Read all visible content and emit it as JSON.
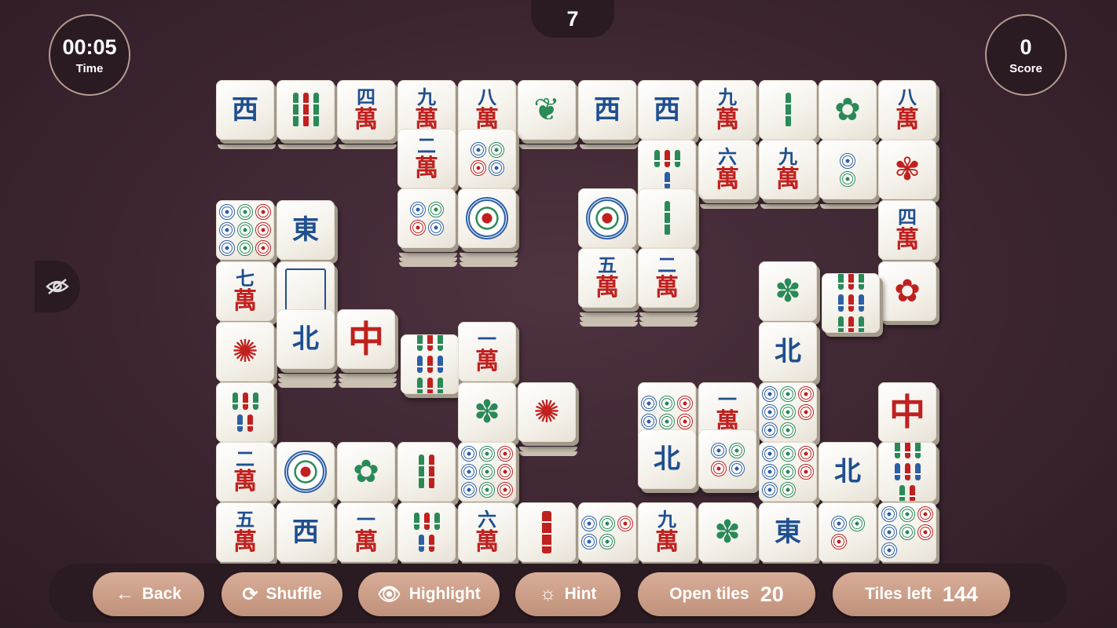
{
  "level": "7",
  "timer": {
    "value": "00:05",
    "label": "Time"
  },
  "score": {
    "value": "0",
    "label": "Score"
  },
  "buttons": {
    "back": "Back",
    "shuffle": "Shuffle",
    "highlight": "Highlight",
    "hint": "Hint"
  },
  "counters": {
    "open_label": "Open tiles",
    "open_value": "20",
    "left_label": "Tiles left",
    "left_value": "144"
  },
  "colors": {
    "background": "#3c2531",
    "panel": "#2a1a22",
    "button": "#c9a08a"
  },
  "tiles": [
    {
      "k": "wind",
      "t": "西"
    },
    {
      "k": "bam",
      "t": "3"
    },
    {
      "k": "crak",
      "n": "四"
    },
    {
      "k": "crak",
      "n": "九"
    },
    {
      "k": "crak",
      "n": "八"
    },
    {
      "k": "plant",
      "t": "❦"
    },
    {
      "k": "wind",
      "t": "西"
    },
    {
      "k": "wind",
      "t": "西"
    },
    {
      "k": "crak",
      "n": "九"
    },
    {
      "k": "bam",
      "t": "1"
    },
    {
      "k": "plant",
      "t": "✿"
    },
    {
      "k": "crak",
      "n": "八"
    },
    {
      "k": "crak",
      "n": "二"
    },
    {
      "k": "dots",
      "t": "4"
    },
    {
      "k": "bam",
      "t": "4"
    },
    {
      "k": "crak",
      "n": "六"
    },
    {
      "k": "crak",
      "n": "九"
    },
    {
      "k": "dots",
      "t": "2"
    },
    {
      "k": "flower",
      "t": "✾"
    },
    {
      "k": "dots",
      "t": "4"
    },
    {
      "k": "bigdot"
    },
    {
      "k": "bigdot"
    },
    {
      "k": "bam",
      "t": "1"
    },
    {
      "k": "crak",
      "n": "四"
    },
    {
      "k": "dots",
      "t": "9"
    },
    {
      "k": "wind",
      "t": "東"
    },
    {
      "k": "crak",
      "n": "五"
    },
    {
      "k": "crak",
      "n": "二"
    },
    {
      "k": "flower",
      "t": "✿"
    },
    {
      "k": "crak",
      "n": "七"
    },
    {
      "k": "white"
    },
    {
      "k": "plant",
      "t": "✽"
    },
    {
      "k": "bam",
      "t": "9"
    },
    {
      "k": "flower",
      "t": "✺"
    },
    {
      "k": "wind",
      "t": "北"
    },
    {
      "k": "dragon",
      "t": "中"
    },
    {
      "k": "bam",
      "t": "9"
    },
    {
      "k": "crak",
      "n": "一"
    },
    {
      "k": "wind",
      "t": "北"
    },
    {
      "k": "bam",
      "t": "5"
    },
    {
      "k": "plant",
      "t": "✽"
    },
    {
      "k": "flower",
      "t": "✺"
    },
    {
      "k": "dots",
      "t": "6"
    },
    {
      "k": "crak",
      "n": "一"
    },
    {
      "k": "dots",
      "t": "8"
    },
    {
      "k": "dragon",
      "t": "中"
    },
    {
      "k": "wind",
      "t": "北"
    },
    {
      "k": "dots",
      "t": "4"
    },
    {
      "k": "dots",
      "t": "8"
    },
    {
      "k": "crak",
      "n": "二"
    },
    {
      "k": "bigdot"
    },
    {
      "k": "plant",
      "t": "✿"
    },
    {
      "k": "bam",
      "t": "2"
    },
    {
      "k": "dots",
      "t": "9"
    },
    {
      "k": "wind",
      "t": "北"
    },
    {
      "k": "bam",
      "t": "8"
    },
    {
      "k": "crak",
      "n": "五"
    },
    {
      "k": "wind",
      "t": "西"
    },
    {
      "k": "crak",
      "n": "一"
    },
    {
      "k": "bam",
      "t": "5"
    },
    {
      "k": "crak",
      "n": "六"
    },
    {
      "k": "bam",
      "t": "1r"
    },
    {
      "k": "dots",
      "t": "5"
    },
    {
      "k": "crak",
      "n": "九"
    },
    {
      "k": "plant",
      "t": "✽"
    },
    {
      "k": "wind",
      "t": "東"
    },
    {
      "k": "dots",
      "t": "3"
    },
    {
      "k": "dots",
      "t": "7"
    }
  ]
}
